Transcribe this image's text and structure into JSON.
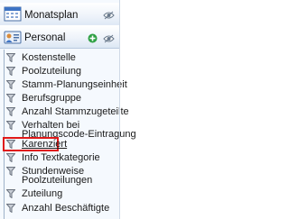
{
  "sections": [
    {
      "title": "Monatsplan",
      "icon": "calendar-icon"
    },
    {
      "title": "Personal",
      "icon": "person-card-icon"
    }
  ],
  "items": [
    {
      "label": "Kostenstelle",
      "icon": "filter-icon"
    },
    {
      "label": "Poolzuteilung",
      "icon": "filter-icon"
    },
    {
      "label": "Stamm-Planungseinheit",
      "icon": "filter-icon"
    },
    {
      "label": "Berufsgruppe",
      "icon": "filter-icon"
    },
    {
      "label": "Anzahl Stammzugeteilte",
      "icon": "filter-icon"
    },
    {
      "label": "Verhalten bei",
      "icon": "filter-icon"
    },
    {
      "label": "Planungscode-Eintragung",
      "icon": "none"
    },
    {
      "label": "Karenziert",
      "icon": "filter-icon"
    },
    {
      "label": "Info Textkategorie",
      "icon": "filter-icon"
    },
    {
      "label": "Stundenweise",
      "icon": "filter-icon"
    },
    {
      "label": "Poolzuteilungen",
      "icon": "none"
    },
    {
      "label": "Zuteilung",
      "icon": "filter-icon"
    },
    {
      "label": "Anzahl Beschäftigte",
      "icon": "filter-icon"
    }
  ],
  "colors": {
    "highlight_border": "#e01818",
    "panel_background": "#f5f9fe",
    "add_button": "#2ea043"
  }
}
